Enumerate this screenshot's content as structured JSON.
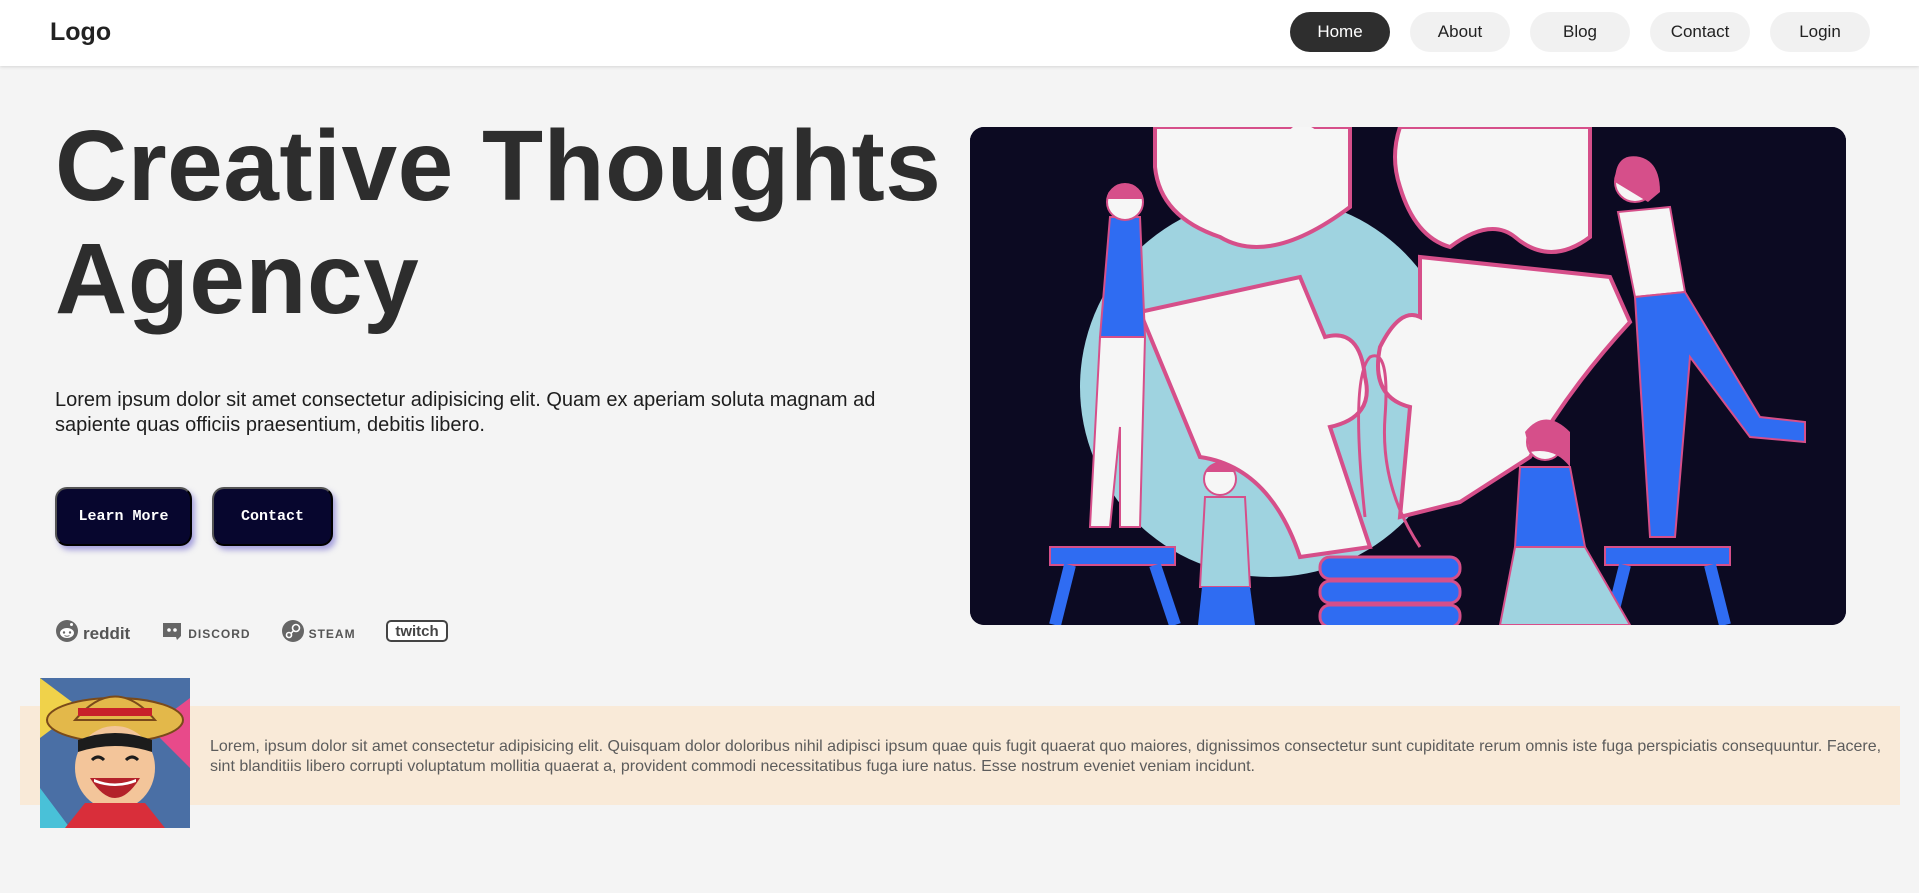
{
  "navbar": {
    "logo": "Logo",
    "links": [
      {
        "label": "Home",
        "active": true
      },
      {
        "label": "About",
        "active": false
      },
      {
        "label": "Blog",
        "active": false
      },
      {
        "label": "Contact",
        "active": false
      },
      {
        "label": "Login",
        "active": false
      }
    ]
  },
  "hero": {
    "title_line1": "Creative Thoughts",
    "title_line2": "Agency",
    "description": "Lorem ipsum dolor sit amet consectetur adipisicing elit. Quam ex aperiam soluta magnam ad sapiente quas officiis praesentium, debitis libero.",
    "buttons": {
      "learn_more": "Learn More",
      "contact": "Contact"
    },
    "brands": [
      {
        "name": "reddit",
        "icon": "reddit-icon"
      },
      {
        "name": "DISCORD",
        "icon": "discord-icon"
      },
      {
        "name": "STEAM",
        "icon": "steam-icon"
      },
      {
        "name": "twitch",
        "icon": "twitch-logo"
      }
    ],
    "illustration": "team-puzzle-illustration"
  },
  "banner": {
    "avatar": "anime-avatar",
    "text": "Lorem, ipsum dolor sit amet consectetur adipisicing elit. Quisquam dolor doloribus nihil adipisci ipsum quae quis fugit quaerat quo maiores, dignissimos consectetur sunt cupiditate rerum omnis iste fuga perspiciatis consequuntur. Facere, sint blanditiis libero corrupti voluptatum mollitia quaerat a, provident commodi necessitatibus fuga iure natus. Esse nostrum eveniet veniam incidunt."
  },
  "colors": {
    "nav_active": "#2e2e2e",
    "button_bg": "#07062e",
    "banner_bg": "#f9ead8",
    "illustration_bg": "#0c0a22",
    "accent_blue": "#2f6cf2",
    "accent_pink": "#d64f8a",
    "accent_teal": "#9fd3e0"
  }
}
